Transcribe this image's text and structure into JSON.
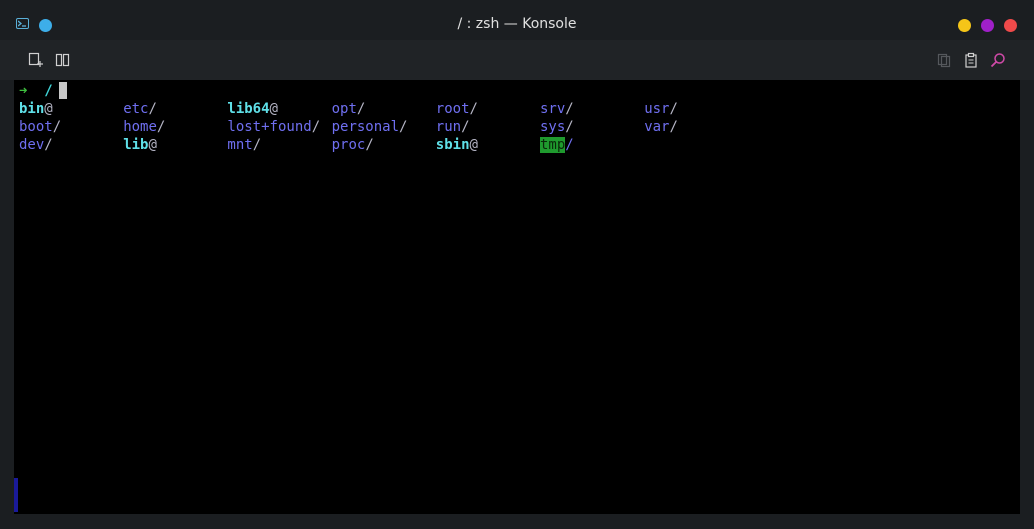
{
  "window": {
    "title": "/ : zsh — Konsole",
    "buttons": {
      "minimize_color": "#f5c518",
      "maximize_color": "#a020c8",
      "close_color": "#ef4a4a"
    },
    "accent": "#3daee9"
  },
  "toolbar": {
    "left_icons": [
      "new-tab-icon",
      "split-view-icon"
    ],
    "right_icons": [
      "copy-icon",
      "paste-icon",
      "find-icon"
    ]
  },
  "terminal": {
    "prompt_arrow": "➜",
    "cwd": "/",
    "listing": [
      {
        "name": "bin",
        "suffix": "@",
        "type": "link"
      },
      {
        "name": "boot",
        "suffix": "/",
        "type": "dir"
      },
      {
        "name": "dev",
        "suffix": "/",
        "type": "dir"
      },
      {
        "name": "etc",
        "suffix": "/",
        "type": "dir"
      },
      {
        "name": "home",
        "suffix": "/",
        "type": "dir"
      },
      {
        "name": "lib",
        "suffix": "@",
        "type": "link"
      },
      {
        "name": "lib64",
        "suffix": "@",
        "type": "link"
      },
      {
        "name": "lost+found",
        "suffix": "/",
        "type": "dir"
      },
      {
        "name": "mnt",
        "suffix": "/",
        "type": "dir"
      },
      {
        "name": "opt",
        "suffix": "/",
        "type": "dir"
      },
      {
        "name": "personal",
        "suffix": "/",
        "type": "dir"
      },
      {
        "name": "proc",
        "suffix": "/",
        "type": "dir"
      },
      {
        "name": "root",
        "suffix": "/",
        "type": "dir"
      },
      {
        "name": "run",
        "suffix": "/",
        "type": "dir"
      },
      {
        "name": "sbin",
        "suffix": "@",
        "type": "link"
      },
      {
        "name": "srv",
        "suffix": "/",
        "type": "dir"
      },
      {
        "name": "sys",
        "suffix": "/",
        "type": "dir"
      },
      {
        "name": "tmp",
        "suffix": "/",
        "type": "sticky"
      },
      {
        "name": "usr",
        "suffix": "/",
        "type": "dir"
      },
      {
        "name": "var",
        "suffix": "/",
        "type": "dir"
      }
    ]
  }
}
